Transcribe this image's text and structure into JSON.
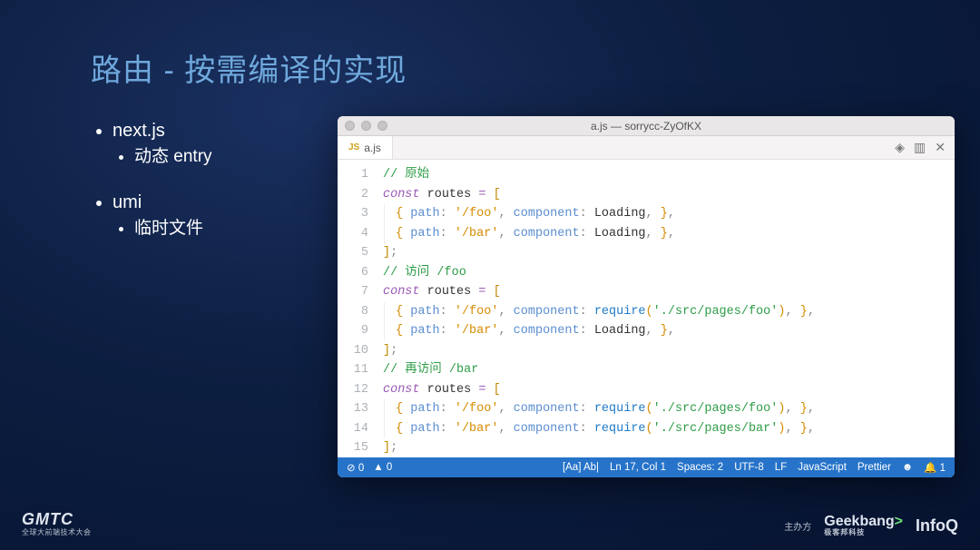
{
  "slide": {
    "title": "路由 - 按需编译的实现",
    "bullets": [
      {
        "label": "next.js",
        "children": [
          {
            "label": "动态 entry"
          }
        ]
      },
      {
        "label": "umi",
        "children": [
          {
            "label": "临时文件"
          }
        ]
      }
    ]
  },
  "editor": {
    "window_title": "a.js — sorrycc-ZyOfKX",
    "tab_filename": "a.js",
    "tab_lang_badge": "JS",
    "code_lines": [
      [
        {
          "t": "comment",
          "v": "// 原始"
        }
      ],
      [
        {
          "t": "kw",
          "v": "const"
        },
        {
          "t": "sp",
          "v": " "
        },
        {
          "t": "var",
          "v": "routes"
        },
        {
          "t": "sp",
          "v": " "
        },
        {
          "t": "op",
          "v": "="
        },
        {
          "t": "sp",
          "v": " "
        },
        {
          "t": "brkt",
          "v": "["
        }
      ],
      [
        {
          "t": "indent",
          "v": ""
        },
        {
          "t": "brace",
          "v": "{"
        },
        {
          "t": "sp",
          "v": " "
        },
        {
          "t": "key",
          "v": "path"
        },
        {
          "t": "punc",
          "v": ":"
        },
        {
          "t": "sp",
          "v": " "
        },
        {
          "t": "str",
          "v": "'/foo'"
        },
        {
          "t": "punc",
          "v": ","
        },
        {
          "t": "sp",
          "v": " "
        },
        {
          "t": "key",
          "v": "component"
        },
        {
          "t": "punc",
          "v": ":"
        },
        {
          "t": "sp",
          "v": " "
        },
        {
          "t": "id",
          "v": "Loading"
        },
        {
          "t": "punc",
          "v": ","
        },
        {
          "t": "sp",
          "v": " "
        },
        {
          "t": "brace",
          "v": "}"
        },
        {
          "t": "punc",
          "v": ","
        }
      ],
      [
        {
          "t": "indent",
          "v": ""
        },
        {
          "t": "brace",
          "v": "{"
        },
        {
          "t": "sp",
          "v": " "
        },
        {
          "t": "key",
          "v": "path"
        },
        {
          "t": "punc",
          "v": ":"
        },
        {
          "t": "sp",
          "v": " "
        },
        {
          "t": "str",
          "v": "'/bar'"
        },
        {
          "t": "punc",
          "v": ","
        },
        {
          "t": "sp",
          "v": " "
        },
        {
          "t": "key",
          "v": "component"
        },
        {
          "t": "punc",
          "v": ":"
        },
        {
          "t": "sp",
          "v": " "
        },
        {
          "t": "id",
          "v": "Loading"
        },
        {
          "t": "punc",
          "v": ","
        },
        {
          "t": "sp",
          "v": " "
        },
        {
          "t": "brace",
          "v": "}"
        },
        {
          "t": "punc",
          "v": ","
        }
      ],
      [
        {
          "t": "brkt",
          "v": "]"
        },
        {
          "t": "punc",
          "v": ";"
        }
      ],
      [
        {
          "t": "comment",
          "v": "// 访问 /foo"
        }
      ],
      [
        {
          "t": "kw",
          "v": "const"
        },
        {
          "t": "sp",
          "v": " "
        },
        {
          "t": "var",
          "v": "routes"
        },
        {
          "t": "sp",
          "v": " "
        },
        {
          "t": "op",
          "v": "="
        },
        {
          "t": "sp",
          "v": " "
        },
        {
          "t": "brkt",
          "v": "["
        }
      ],
      [
        {
          "t": "indent",
          "v": ""
        },
        {
          "t": "brace",
          "v": "{"
        },
        {
          "t": "sp",
          "v": " "
        },
        {
          "t": "key",
          "v": "path"
        },
        {
          "t": "punc",
          "v": ":"
        },
        {
          "t": "sp",
          "v": " "
        },
        {
          "t": "str",
          "v": "'/foo'"
        },
        {
          "t": "punc",
          "v": ","
        },
        {
          "t": "sp",
          "v": " "
        },
        {
          "t": "key",
          "v": "component"
        },
        {
          "t": "punc",
          "v": ":"
        },
        {
          "t": "sp",
          "v": " "
        },
        {
          "t": "fn",
          "v": "require"
        },
        {
          "t": "brace",
          "v": "("
        },
        {
          "t": "str2",
          "v": "'./src/pages/foo'"
        },
        {
          "t": "brace",
          "v": ")"
        },
        {
          "t": "punc",
          "v": ","
        },
        {
          "t": "sp",
          "v": " "
        },
        {
          "t": "brace",
          "v": "}"
        },
        {
          "t": "punc",
          "v": ","
        }
      ],
      [
        {
          "t": "indent",
          "v": ""
        },
        {
          "t": "brace",
          "v": "{"
        },
        {
          "t": "sp",
          "v": " "
        },
        {
          "t": "key",
          "v": "path"
        },
        {
          "t": "punc",
          "v": ":"
        },
        {
          "t": "sp",
          "v": " "
        },
        {
          "t": "str",
          "v": "'/bar'"
        },
        {
          "t": "punc",
          "v": ","
        },
        {
          "t": "sp",
          "v": " "
        },
        {
          "t": "key",
          "v": "component"
        },
        {
          "t": "punc",
          "v": ":"
        },
        {
          "t": "sp",
          "v": " "
        },
        {
          "t": "id",
          "v": "Loading"
        },
        {
          "t": "punc",
          "v": ","
        },
        {
          "t": "sp",
          "v": " "
        },
        {
          "t": "brace",
          "v": "}"
        },
        {
          "t": "punc",
          "v": ","
        }
      ],
      [
        {
          "t": "brkt",
          "v": "]"
        },
        {
          "t": "punc",
          "v": ";"
        }
      ],
      [
        {
          "t": "comment",
          "v": "// 再访问 /bar"
        }
      ],
      [
        {
          "t": "kw",
          "v": "const"
        },
        {
          "t": "sp",
          "v": " "
        },
        {
          "t": "var",
          "v": "routes"
        },
        {
          "t": "sp",
          "v": " "
        },
        {
          "t": "op",
          "v": "="
        },
        {
          "t": "sp",
          "v": " "
        },
        {
          "t": "brkt",
          "v": "["
        }
      ],
      [
        {
          "t": "indent",
          "v": ""
        },
        {
          "t": "brace",
          "v": "{"
        },
        {
          "t": "sp",
          "v": " "
        },
        {
          "t": "key",
          "v": "path"
        },
        {
          "t": "punc",
          "v": ":"
        },
        {
          "t": "sp",
          "v": " "
        },
        {
          "t": "str",
          "v": "'/foo'"
        },
        {
          "t": "punc",
          "v": ","
        },
        {
          "t": "sp",
          "v": " "
        },
        {
          "t": "key",
          "v": "component"
        },
        {
          "t": "punc",
          "v": ":"
        },
        {
          "t": "sp",
          "v": " "
        },
        {
          "t": "fn",
          "v": "require"
        },
        {
          "t": "brace",
          "v": "("
        },
        {
          "t": "str2",
          "v": "'./src/pages/foo'"
        },
        {
          "t": "brace",
          "v": ")"
        },
        {
          "t": "punc",
          "v": ","
        },
        {
          "t": "sp",
          "v": " "
        },
        {
          "t": "brace",
          "v": "}"
        },
        {
          "t": "punc",
          "v": ","
        }
      ],
      [
        {
          "t": "indent",
          "v": ""
        },
        {
          "t": "brace",
          "v": "{"
        },
        {
          "t": "sp",
          "v": " "
        },
        {
          "t": "key",
          "v": "path"
        },
        {
          "t": "punc",
          "v": ":"
        },
        {
          "t": "sp",
          "v": " "
        },
        {
          "t": "str",
          "v": "'/bar'"
        },
        {
          "t": "punc",
          "v": ","
        },
        {
          "t": "sp",
          "v": " "
        },
        {
          "t": "key",
          "v": "component"
        },
        {
          "t": "punc",
          "v": ":"
        },
        {
          "t": "sp",
          "v": " "
        },
        {
          "t": "fn",
          "v": "require"
        },
        {
          "t": "brace",
          "v": "("
        },
        {
          "t": "str2",
          "v": "'./src/pages/bar'"
        },
        {
          "t": "brace",
          "v": ")"
        },
        {
          "t": "punc",
          "v": ","
        },
        {
          "t": "sp",
          "v": " "
        },
        {
          "t": "brace",
          "v": "}"
        },
        {
          "t": "punc",
          "v": ","
        }
      ],
      [
        {
          "t": "brkt",
          "v": "]"
        },
        {
          "t": "punc",
          "v": ";"
        }
      ]
    ],
    "status": {
      "errors": "0",
      "warnings": "0",
      "search_markers": "[Aa]   Ab|",
      "cursor": "Ln 17, Col 1",
      "spaces": "Spaces: 2",
      "encoding": "UTF-8",
      "eol": "LF",
      "language": "JavaScript",
      "formatter": "Prettier",
      "notifications": "1"
    }
  },
  "footer": {
    "left_logo": "GMTC",
    "left_sub": "全球大前端技术大会",
    "sponsor_label": "主办方",
    "geekbang": "Geekbang",
    "geekbang_sub": "极客邦科技",
    "infoq": "InfoQ"
  }
}
